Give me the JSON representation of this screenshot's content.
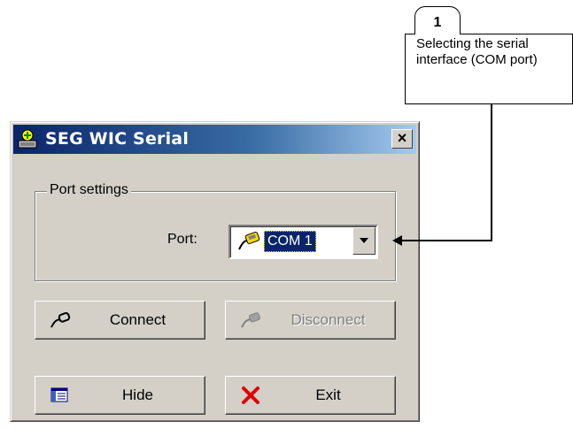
{
  "callout": {
    "number": "1",
    "text_line1": "Selecting the serial",
    "text_line2": "interface (COM port)"
  },
  "window": {
    "title": "SEG WIC Serial",
    "close_label": "×"
  },
  "port_settings": {
    "group_label": "Port settings",
    "port_label": "Port:",
    "selected_port": "COM 1"
  },
  "buttons": {
    "connect": "Connect",
    "disconnect": "Disconnect",
    "disconnect_enabled": false,
    "hide": "Hide",
    "exit": "Exit"
  },
  "icons": {
    "title": "app-icon",
    "combo": "serial-plug-icon",
    "connect": "plug-icon",
    "disconnect": "plug-disabled-icon",
    "hide": "window-list-icon",
    "exit": "red-x-icon"
  },
  "colors": {
    "title_gradient_start": "#0a246a",
    "title_gradient_end": "#a6caf0",
    "selection": "#0a246a",
    "face": "#d4d0c8",
    "exit_x": "#e00000"
  }
}
